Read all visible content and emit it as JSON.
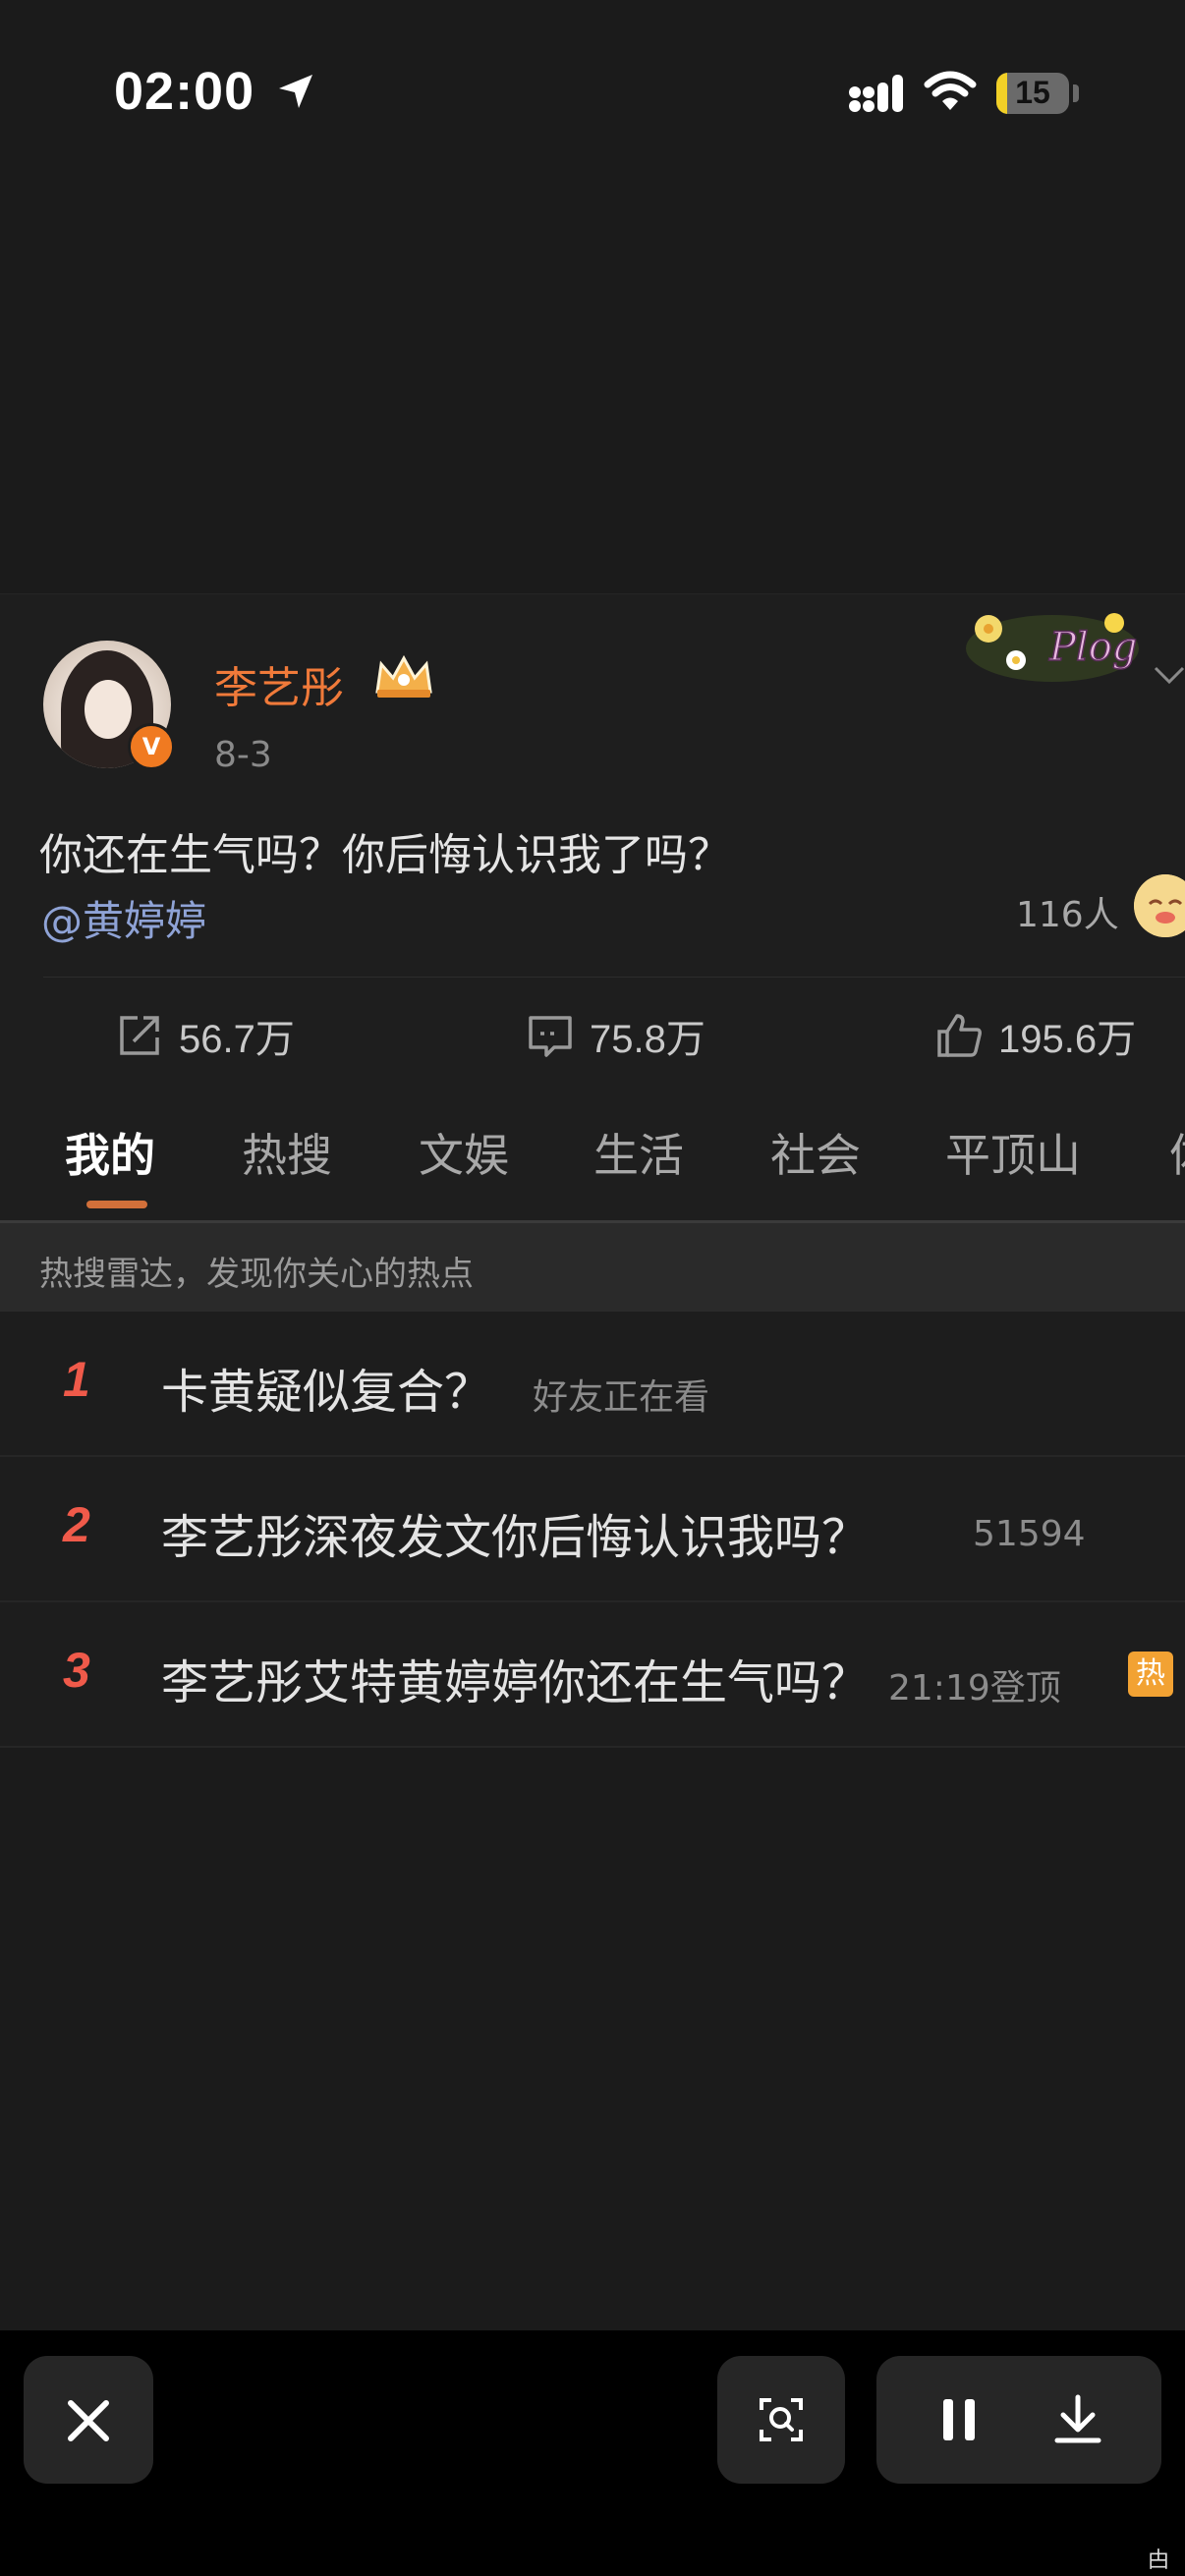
{
  "status_bar": {
    "time": "02:00",
    "battery_level": "15",
    "icons": [
      "location-arrow-icon",
      "signal-icon",
      "wifi-icon",
      "battery-icon"
    ],
    "battery_color": "#f2d027"
  },
  "post": {
    "author": "李艺彤",
    "date": "8-3",
    "text": "你还在生气吗？你后悔认识我了吗？",
    "mention": "@黄婷婷",
    "viewer_count": "116人",
    "author_color": "#f07a3a",
    "mention_color": "#8fa3d6",
    "sticker_text": "Plog",
    "verified_mark": "V",
    "stats": {
      "reposts": "56.7万",
      "comments": "75.8万",
      "likes": "195.6万"
    }
  },
  "tabs": [
    "我的",
    "热搜",
    "文娱",
    "生活",
    "社会",
    "平顶山",
    "体"
  ],
  "active_tab": "我的",
  "radar_text": "热搜雷达，发现你关心的热点",
  "hot_list": [
    {
      "rank": "1",
      "title": "卡黄疑似复合？",
      "meta": "好友正在看",
      "badge": ""
    },
    {
      "rank": "2",
      "title": "李艺彤深夜发文你后悔认识我吗？",
      "meta": "51594",
      "badge": ""
    },
    {
      "rank": "3",
      "title": "李艺彤艾特黄婷婷你还在生气吗？",
      "meta": "21:19登顶",
      "badge": "热"
    }
  ],
  "rank_color": "#f05a4a",
  "hot_badge_color": "#f2a233",
  "bottom_bar": {
    "buttons": [
      "close-icon",
      "visual-search-icon",
      "pause-icon",
      "download-icon"
    ],
    "corner_glyph": "甴"
  }
}
